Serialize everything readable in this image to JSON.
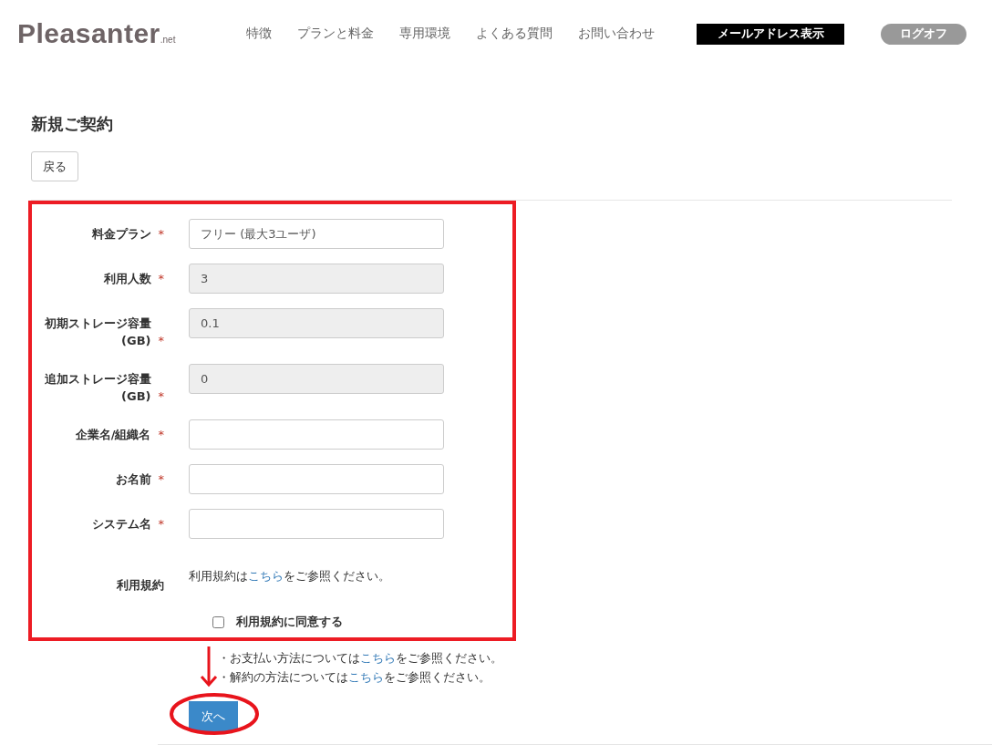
{
  "header": {
    "logo": {
      "name": "Pleasanter",
      "suffix": ".net"
    },
    "nav": [
      "特徴",
      "プランと料金",
      "専用環境",
      "よくある質問",
      "お問い合わせ"
    ],
    "email_button": "メールアドレス表示",
    "logoff_button": "ログオフ"
  },
  "page_title": "新規ご契約",
  "back_button": "戻る",
  "fields": [
    {
      "label": "料金プラン",
      "required_mark": "*",
      "value": "フリー (最大3ユーザ)",
      "disabled": false
    },
    {
      "label": "利用人数",
      "required_mark": "*",
      "value": "3",
      "disabled": true
    },
    {
      "label": "初期ストレージ容量 (GB)",
      "required_mark": "*",
      "value": "0.1",
      "disabled": true
    },
    {
      "label": "追加ストレージ容量 (GB)",
      "required_mark": "*",
      "value": "0",
      "disabled": true
    },
    {
      "label": "企業名/組織名",
      "required_mark": "*",
      "disabled": false
    },
    {
      "label": "お名前",
      "required_mark": "*",
      "disabled": false
    },
    {
      "label": "システム名",
      "required_mark": "*",
      "disabled": false
    }
  ],
  "terms": {
    "label": "利用規約",
    "before": "利用規約は",
    "link": "こちら",
    "after": "をご参照ください。",
    "agree_label": "利用規約に同意する",
    "checked": false
  },
  "notes": [
    {
      "before": "・お支払い方法については",
      "link": "こちら",
      "after": "をご参照ください。"
    },
    {
      "before": "・解約の方法については",
      "link": "こちら",
      "after": "をご参照ください。"
    }
  ],
  "next_button": "次へ"
}
